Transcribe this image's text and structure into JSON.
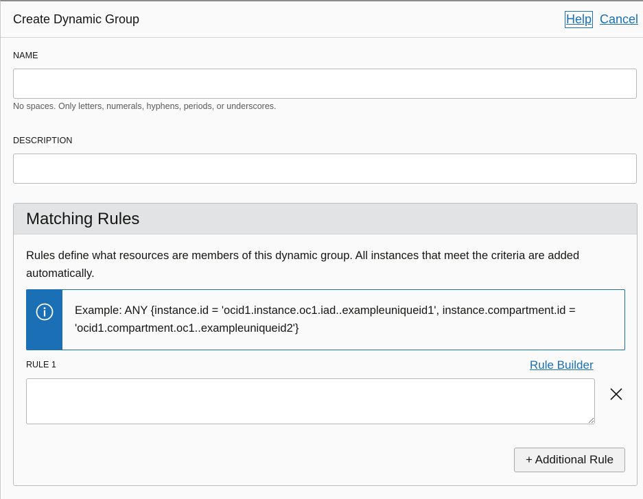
{
  "header": {
    "title": "Create Dynamic Group",
    "help_label": "Help",
    "cancel_label": "Cancel"
  },
  "form": {
    "name": {
      "label": "NAME",
      "value": "",
      "hint": "No spaces. Only letters, numerals, hyphens, periods, or underscores."
    },
    "description": {
      "label": "DESCRIPTION",
      "value": ""
    }
  },
  "matching_rules": {
    "title": "Matching Rules",
    "description": "Rules define what resources are members of this dynamic group. All instances that meet the criteria are added automatically.",
    "info_icon": "info-circle-icon",
    "example": "Example: ANY {instance.id = 'ocid1.instance.oc1.iad..exampleuniqueid1', instance.compartment.id = 'ocid1.compartment.oc1..exampleuniqueid2'}",
    "rules": [
      {
        "label": "RULE 1",
        "value": "",
        "builder_label": "Rule Builder",
        "remove_icon": "close-icon"
      }
    ],
    "add_rule_label": "+ Additional Rule"
  },
  "colors": {
    "accent": "#1a6fb5",
    "header_bg": "#e2e3e4",
    "page_bg": "#fafafa"
  }
}
